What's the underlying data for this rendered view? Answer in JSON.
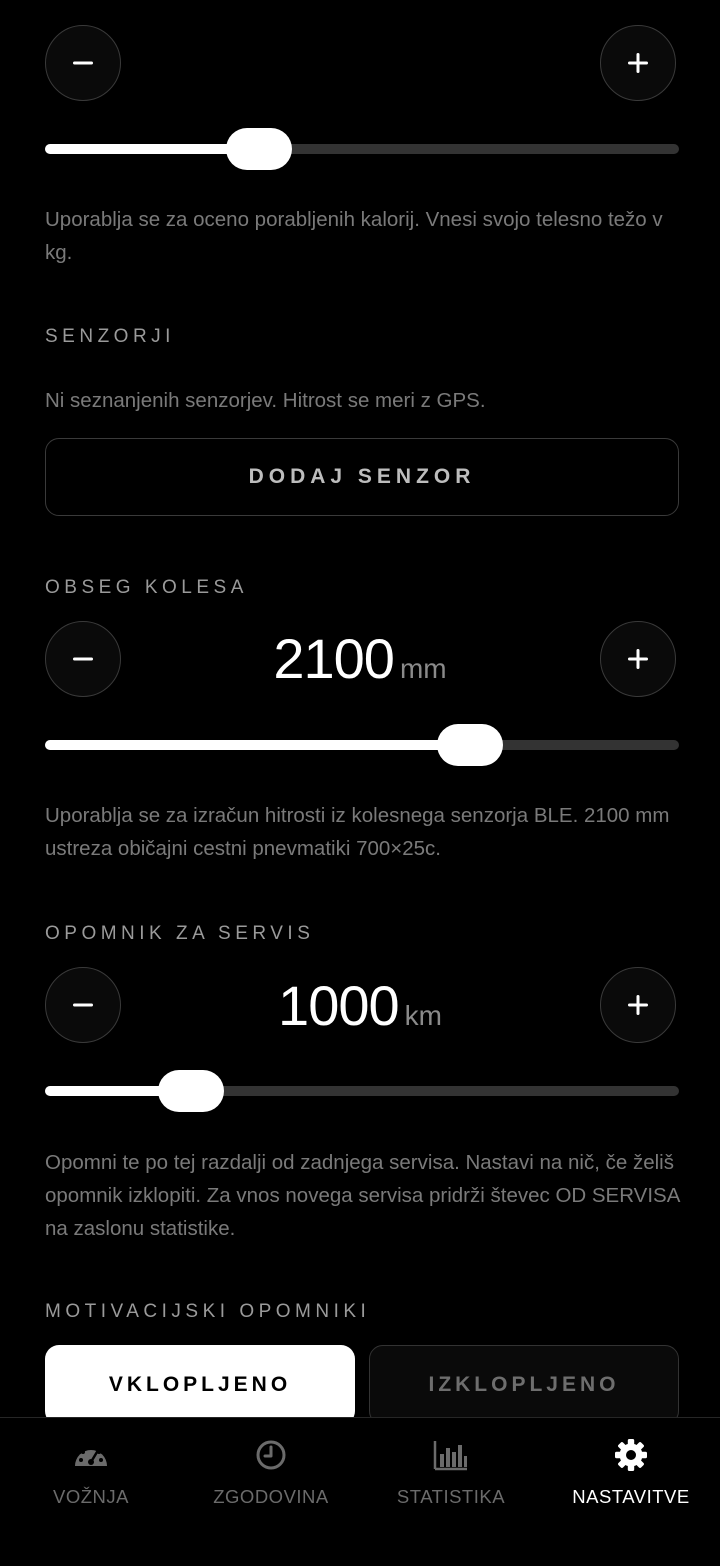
{
  "weight": {
    "value": 0.34,
    "help": "Uporablja se za oceno porabljenih kalorij. Vnesi svojo telesno težo v kg."
  },
  "sensors": {
    "label": "SENZORJI",
    "status": "Ni seznanjenih senzorjev. Hitrost se meri z GPS.",
    "add_button": "DODAJ SENZOR"
  },
  "wheel": {
    "label": "OBSEG KOLESA",
    "value": "2100",
    "unit": "mm",
    "slider_fraction": 0.67,
    "help": "Uporablja se za izračun hitrosti iz kolesnega senzorja BLE. 2100 mm ustreza običajni cestni pnevmatiki 700×25c."
  },
  "service": {
    "label": "OPOMNIK ZA SERVIS",
    "value": "1000",
    "unit": "km",
    "slider_fraction": 0.23,
    "help": "Opomni te po tej razdalji od zadnjega servisa. Nastavi na nič, če želiš opomnik izklopiti. Za vnos novega servisa pridrži števec OD SERVISA na zaslonu statistike."
  },
  "motivation": {
    "label": "MOTIVACIJSKI OPOMNIKI",
    "on": "VKLOPLJENO",
    "off": "IZKLOPLJENO"
  },
  "tabs": [
    {
      "label": "VOŽNJA",
      "icon": "speedometer-icon",
      "active": false
    },
    {
      "label": "ZGODOVINA",
      "icon": "clock-icon",
      "active": false
    },
    {
      "label": "STATISTIKA",
      "icon": "bar-chart-icon",
      "active": false
    },
    {
      "label": "NASTAVITVE",
      "icon": "gear-icon",
      "active": true
    }
  ],
  "colors": {
    "background": "#000000",
    "accent": "#ffffff",
    "muted_text": "#7a7a7a",
    "track": "#333333"
  }
}
